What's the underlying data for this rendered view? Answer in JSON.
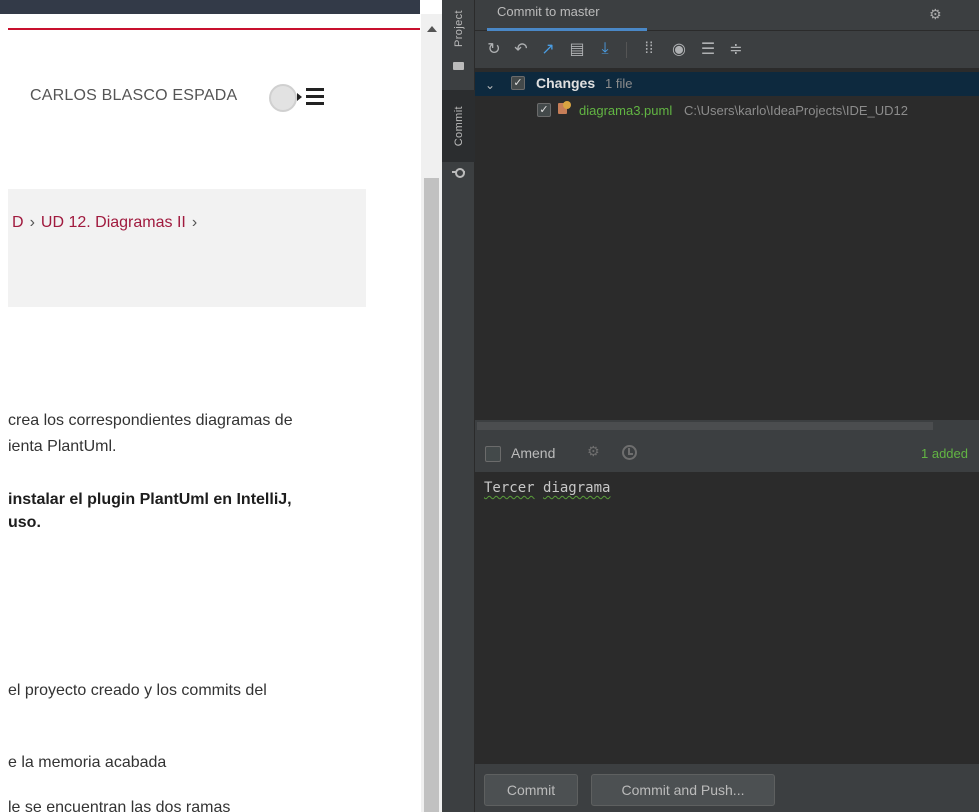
{
  "browser": {
    "user_name": "CARLOS BLASCO ESPADA",
    "breadcrumb": {
      "prev_fragment": "D",
      "separator": "›",
      "current": "UD 12. Diagramas II",
      "trailing_separator": "›"
    },
    "lines": [
      "crea los correspondientes diagramas de",
      "ienta PlantUml.",
      "instalar el plugin PlantUml en IntelliJ,",
      "uso.",
      "el proyecto creado y los commits del",
      "e la memoria acabada",
      "le se encuentran las dos ramas"
    ]
  },
  "tool_strip": {
    "project_tab": "Project",
    "commit_tab": "Commit"
  },
  "ide": {
    "title": "Commit to master",
    "toolbar_icons": [
      "refresh-icon",
      "rollback-icon",
      "show-diff-icon",
      "changelist-icon",
      "update-icon",
      "group-by-icon",
      "view-options-icon",
      "expand-all-icon",
      "collapse-all-icon"
    ],
    "changes": {
      "group_label": "Changes",
      "group_count": "1 file",
      "file_name": "diagrama3.puml",
      "file_path": "C:\\Users\\karlo\\IdeaProjects\\IDE_UD12"
    },
    "amend_label": "Amend",
    "added_status": "1 added",
    "commit_message": {
      "word1": "Tercer",
      "word2": "diagrama"
    },
    "buttons": {
      "commit": "Commit",
      "commit_and_push": "Commit and Push..."
    },
    "colors": {
      "background": "#3c3f41",
      "panel": "#2b2b2b",
      "selection": "#0d293e",
      "added_green": "#62b543",
      "accent_blue": "#4a88c7"
    }
  }
}
